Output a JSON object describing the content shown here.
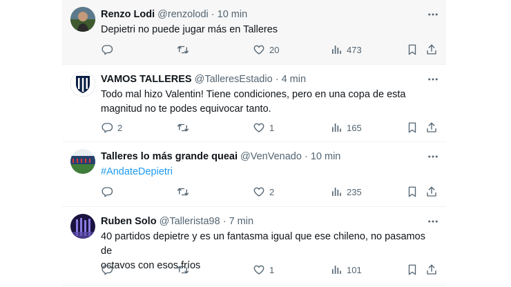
{
  "tweets": [
    {
      "name": "Renzo Lodi",
      "handle": "@renzolodi",
      "sep": "·",
      "time": "10 min",
      "text": "Depietri no puede jugar más en Talleres",
      "replies": "",
      "retweets": "",
      "likes": "20",
      "views": "473"
    },
    {
      "name": "VAMOS TALLERES",
      "handle": "@TalleresEstadio",
      "sep": "·",
      "time": "4 min",
      "text_line1": "Todo mal hizo Valentin! Tiene condiciones, pero en una copa de esta",
      "text_line2": "magnitud no te podes equivocar tanto.",
      "replies": "2",
      "retweets": "",
      "likes": "1",
      "views": "165"
    },
    {
      "name": "Talleres lo más grande queai",
      "handle": "@VenVenado",
      "sep": "·",
      "time": "10 min",
      "text": "#AndateDepietri",
      "replies": "",
      "retweets": "",
      "likes": "2",
      "views": "235"
    },
    {
      "name": "Ruben Solo",
      "handle": "@Tallerista98",
      "sep": "·",
      "time": "7 min",
      "text_line1": "40 partidos depietre y es un fantasma igual que ese chileno, no pasamos de",
      "text_line2": "octavos con esos fríos",
      "replies": "",
      "retweets": "",
      "likes": "1",
      "views": "101"
    }
  ],
  "colors": {
    "link": "#1d9bf0",
    "muted": "#536471",
    "text": "#0f1419"
  },
  "icons": [
    "reply-icon",
    "retweet-icon",
    "like-icon",
    "views-icon",
    "bookmark-icon",
    "share-icon",
    "more-icon"
  ]
}
